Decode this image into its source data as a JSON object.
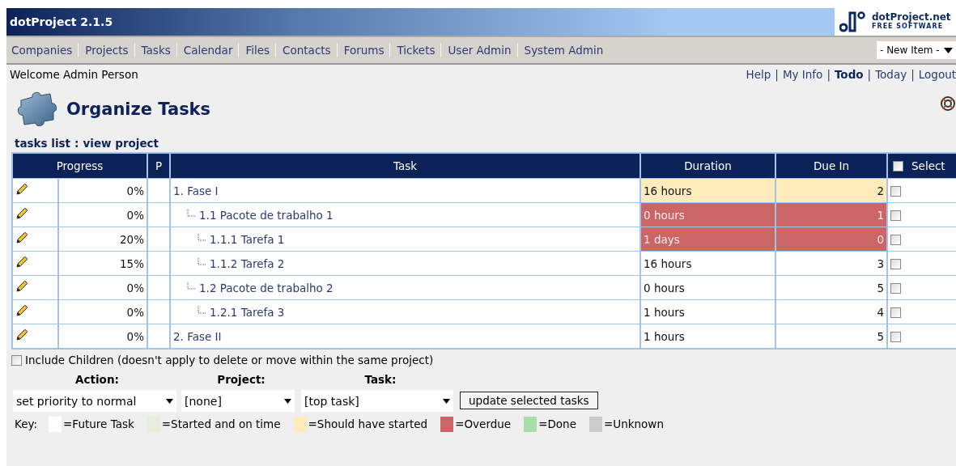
{
  "app_title": "dotProject 2.1.5",
  "logo": {
    "name": "dotProject.net",
    "tagline": "FREE SOFTWARE"
  },
  "nav": [
    "Companies",
    "Projects",
    "Tasks",
    "Calendar",
    "Files",
    "Contacts",
    "Forums",
    "Tickets",
    "User Admin",
    "System Admin"
  ],
  "new_item": {
    "value": "- New Item -"
  },
  "welcome": "Welcome Admin Person",
  "user_links": [
    {
      "label": "Help",
      "selected": false
    },
    {
      "label": "My Info",
      "selected": false
    },
    {
      "label": "Todo",
      "selected": true
    },
    {
      "label": "Today",
      "selected": false
    },
    {
      "label": "Logout",
      "selected": false
    }
  ],
  "link_separator": "|",
  "page_title": "Organize Tasks",
  "breadcrumbs": [
    {
      "label": "tasks list"
    },
    {
      "label": "view project"
    }
  ],
  "breadcrumb_separator": ":",
  "table": {
    "columns": [
      "Progress",
      "P",
      "Task",
      "Duration",
      "Due In",
      "Select"
    ],
    "select_all_checked": false,
    "rows": [
      {
        "progress": "0%",
        "task": "1. Fase I",
        "duration": "16 hours",
        "due_in": "2",
        "color": "#ffebbc",
        "checked": false,
        "children": [
          {
            "progress": "0%",
            "task": "1.1 Pacote de trabalho 1",
            "duration": "0 hours",
            "due_in": "1",
            "color": "#cc6666",
            "checked": false,
            "children": [
              {
                "progress": "20%",
                "task": "1.1.1 Tarefa 1",
                "duration": "1 days",
                "due_in": "0",
                "color": "#cc6666",
                "checked": false
              },
              {
                "progress": "15%",
                "task": "1.1.2 Tarefa 2",
                "duration": "16 hours",
                "due_in": "3",
                "color": "#ffffff",
                "checked": false
              }
            ]
          },
          {
            "progress": "0%",
            "task": "1.2 Pacote de trabalho 2",
            "duration": "0 hours",
            "due_in": "5",
            "color": "#ffffff",
            "checked": false,
            "children": [
              {
                "progress": "0%",
                "task": "1.2.1 Tarefa 3",
                "duration": "1 hours",
                "due_in": "4",
                "color": "#ffffff",
                "checked": false
              }
            ]
          }
        ]
      },
      {
        "progress": "0%",
        "task": "2. Fase II",
        "duration": "1 hours",
        "due_in": "5",
        "color": "#ffffff",
        "checked": false
      }
    ]
  },
  "include_children": {
    "label": "Include Children (doesn't apply to delete or move within the same project)",
    "checked": false
  },
  "form": {
    "fields": [
      {
        "label": "Action:",
        "value": "set priority to normal"
      },
      {
        "label": "Project:",
        "value": "[none]"
      },
      {
        "label": "Task:",
        "value": "[top task]"
      }
    ],
    "button": "update selected tasks"
  },
  "key": {
    "label": "Key:",
    "items": [
      {
        "label": "=Future Task",
        "color": "#ffffff"
      },
      {
        "label": "=Started and on time",
        "color": "#e6eedd"
      },
      {
        "label": "=Should have started",
        "color": "#ffebbc"
      },
      {
        "label": "=Overdue",
        "color": "#cc6666"
      },
      {
        "label": "=Done",
        "color": "#aaddaa"
      },
      {
        "label": "=Unknown",
        "color": "#cccccc"
      }
    ]
  }
}
